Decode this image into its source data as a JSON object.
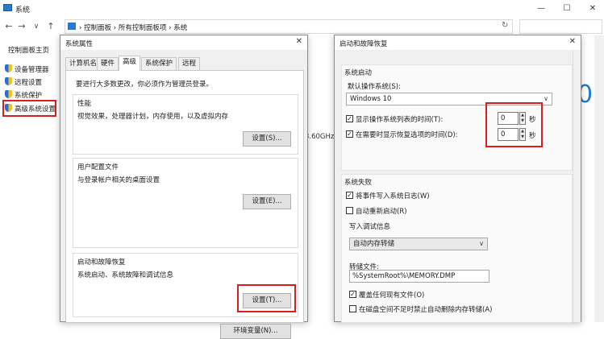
{
  "bg_window": {
    "title": "系统",
    "controls": [
      "—",
      "☐",
      "✕"
    ],
    "nav": {
      "back": "←",
      "forward": "→",
      "down": "∨",
      "up": "↑"
    },
    "breadcrumb": "›  控制面板  ›  所有控制面板项  ›  系统",
    "refresh": "↻",
    "sidebar_home": "控制面板主页",
    "sidebar_items": [
      "设备管理器",
      "远程设置",
      "系统保护",
      "高级系统设置"
    ],
    "big_text": "0",
    "ghz_text": "3.60GHz"
  },
  "dialog1": {
    "title": "系统属性",
    "close": "✕",
    "tabs": [
      "计算机名",
      "硬件",
      "高级",
      "系统保护",
      "远程"
    ],
    "admin_note": "要进行大多数更改，你必须作为管理员登录。",
    "perf": {
      "title": "性能",
      "desc": "视觉效果，处理器计划，内存使用，以及虚拟内存",
      "button": "设置(S)..."
    },
    "profile": {
      "title": "用户配置文件",
      "desc": "与登录帐户相关的桌面设置",
      "button": "设置(E)..."
    },
    "startup": {
      "title": "启动和故障恢复",
      "desc": "系统启动、系统故障和调试信息",
      "button": "设置(T)..."
    },
    "env_button": "环境变量(N)..."
  },
  "dialog2": {
    "title": "启动和故障恢复",
    "close": "✕",
    "startup_section": "系统启动",
    "default_os_label": "默认操作系统(S):",
    "default_os_value": "Windows 10",
    "show_list_label": "显示操作系统列表的时间(T):",
    "show_list_value": "0",
    "show_recovery_label": "在需要时显示恢复选项的时间(D):",
    "show_recovery_value": "0",
    "seconds": "秒",
    "failure_section": "系统失败",
    "write_log_label": "将事件写入系统日志(W)",
    "auto_restart_label": "自动重新启动(R)",
    "debug_info_label": "写入调试信息",
    "debug_info_value": "自动内存转储",
    "dump_file_label": "转储文件:",
    "dump_file_value": "%SystemRoot%\\MEMORY.DMP",
    "overwrite_label": "覆盖任何现有文件(O)",
    "disable_delete_label": "在磁盘空间不足时禁止自动删除内存转储(A)",
    "check": "✓",
    "chev": "∨",
    "spin_up": "▲",
    "spin_down": "▼"
  }
}
